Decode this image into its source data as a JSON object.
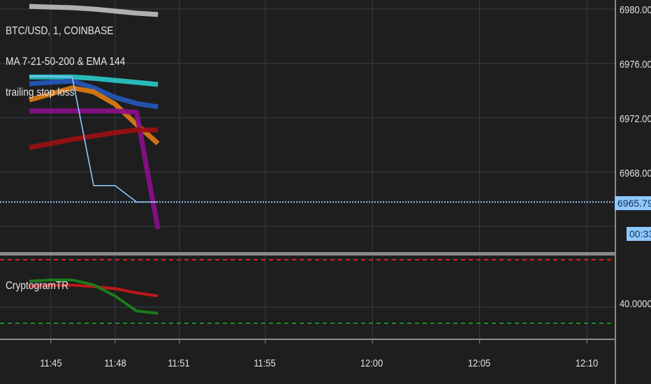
{
  "chart_data": [
    {
      "type": "line",
      "title": "BTC/USD, 1, COINBASE",
      "indicator_label": "MA 7-21-50-200 & EMA 144",
      "extra_label": "trailing stop loss",
      "ylim": [
        6962,
        6981
      ],
      "y_ticks": [
        "6980.00",
        "6976.00",
        "6972.00",
        "6968.00"
      ],
      "current_price": "6965.79",
      "countdown": "00:33",
      "x": [
        "11:44",
        "11:45",
        "11:46",
        "11:47",
        "11:48",
        "11:49",
        "11:50"
      ],
      "series": [
        {
          "color": "#bdbdbd",
          "values": [
            6980.2,
            6980.15,
            6980.1,
            6980.0,
            6979.85,
            6979.7,
            6979.6
          ]
        },
        {
          "color": "#2ac7c7",
          "values": [
            6975.0,
            6975.0,
            6975.0,
            6974.9,
            6974.75,
            6974.6,
            6974.45
          ]
        },
        {
          "color": "#2458b8",
          "values": [
            6974.5,
            6974.6,
            6974.7,
            6974.2,
            6973.5,
            6973.05,
            6972.8
          ]
        },
        {
          "color": "#e07b14",
          "values": [
            6973.3,
            6973.75,
            6974.2,
            6973.9,
            6973.0,
            6971.5,
            6970.1
          ]
        },
        {
          "color": "#8a0f8a",
          "values": [
            6972.5,
            6972.5,
            6972.5,
            6972.5,
            6972.5,
            6972.4,
            6963.8
          ]
        },
        {
          "color": "#9a1010",
          "values": [
            6969.8,
            6970.1,
            6970.4,
            6970.65,
            6970.9,
            6971.1,
            6971.1
          ]
        },
        {
          "color": "#8fc8ff",
          "values": [
            6975.05,
            6975.05,
            6975.0,
            6967.0,
            6967.0,
            6965.79,
            6965.79
          ]
        }
      ]
    },
    {
      "type": "line",
      "title": "CryptogramTR",
      "y_ticks": [
        "40.0000"
      ],
      "series": [
        {
          "color": "#c01818",
          "values": [
            48.5,
            48.8,
            48.9,
            48.3,
            47.5,
            45.8,
            44.5
          ]
        },
        {
          "color": "#1c7a1c",
          "values": [
            50.5,
            51.0,
            51.0,
            49.0,
            44.5,
            38.5,
            37.5
          ]
        }
      ]
    }
  ],
  "x_axis_ticks": [
    "11:45",
    "11:48",
    "11:51",
    "11:55",
    "12:00",
    "12:05",
    "12:10"
  ]
}
